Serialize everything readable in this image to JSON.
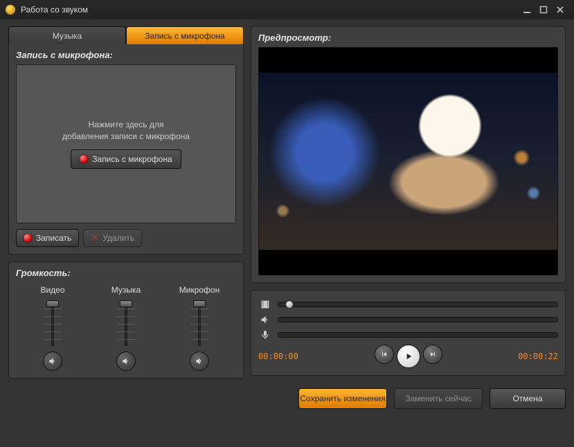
{
  "window": {
    "title": "Работа со звуком"
  },
  "tabs": {
    "music": "Музыка",
    "mic": "Запись с микрофона"
  },
  "recording": {
    "panel_title": "Запись с микрофона:",
    "hint_line1": "Нажмите здесь для",
    "hint_line2": "добавления записи с микрофона",
    "mic_button": "Запись с микрофона",
    "record_button": "Записать",
    "delete_button": "Удалить"
  },
  "volume": {
    "panel_title": "Громкость:",
    "video_label": "Видео",
    "music_label": "Музыка",
    "mic_label": "Микрофон"
  },
  "preview": {
    "panel_title": "Предпросмотр:",
    "time_current": "00:00:00",
    "time_total": "00:00:22"
  },
  "footer": {
    "save": "Сохранить изменения",
    "replace": "Заменить сейчас",
    "cancel": "Отмена"
  }
}
